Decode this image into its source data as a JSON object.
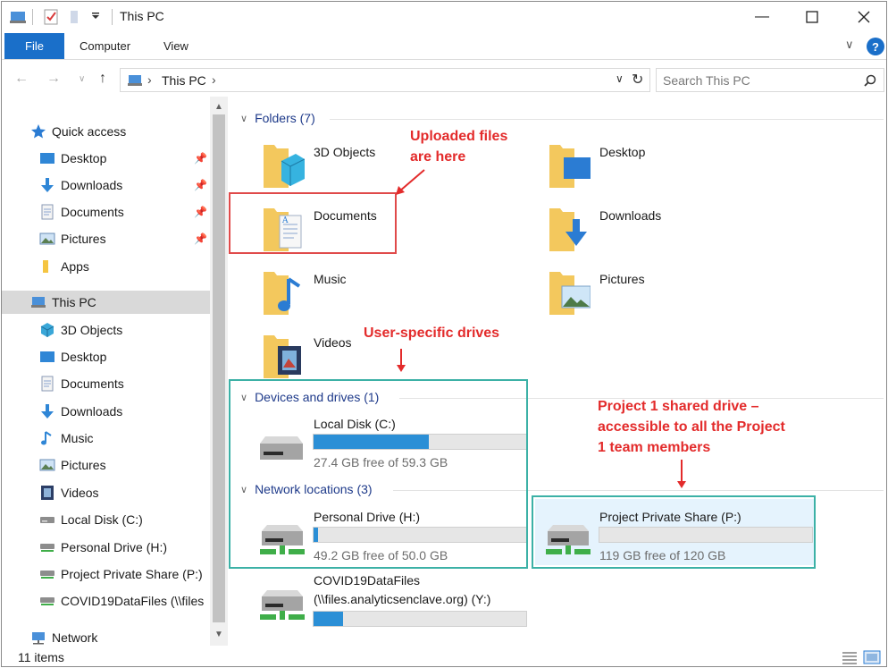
{
  "window": {
    "title": "This PC"
  },
  "ribbon": {
    "tabs": [
      "File",
      "Computer",
      "View"
    ],
    "help": "?"
  },
  "address": {
    "path": [
      "This PC"
    ],
    "search_placeholder": "Search This PC"
  },
  "sidebar": {
    "quick_access": "Quick access",
    "quick_items": [
      {
        "label": "Desktop",
        "icon": "desktop-icon",
        "pinned": true
      },
      {
        "label": "Downloads",
        "icon": "download-icon",
        "pinned": true
      },
      {
        "label": "Documents",
        "icon": "document-icon",
        "pinned": true
      },
      {
        "label": "Pictures",
        "icon": "pictures-icon",
        "pinned": true
      },
      {
        "label": "Apps",
        "icon": "folder-icon",
        "pinned": false
      }
    ],
    "this_pc": "This PC",
    "pc_items": [
      {
        "label": "3D Objects",
        "icon": "cube-icon"
      },
      {
        "label": "Desktop",
        "icon": "desktop-icon"
      },
      {
        "label": "Documents",
        "icon": "document-icon"
      },
      {
        "label": "Downloads",
        "icon": "download-icon"
      },
      {
        "label": "Music",
        "icon": "music-icon"
      },
      {
        "label": "Pictures",
        "icon": "pictures-icon"
      },
      {
        "label": "Videos",
        "icon": "videos-icon"
      },
      {
        "label": "Local Disk (C:)",
        "icon": "disk-icon"
      },
      {
        "label": "Personal Drive (H:)",
        "icon": "network-drive-icon"
      },
      {
        "label": "Project Private Share (P:)",
        "icon": "network-drive-icon"
      },
      {
        "label": "COVID19DataFiles (\\\\files",
        "icon": "network-drive-icon"
      }
    ],
    "network": "Network"
  },
  "content": {
    "folders_header": "Folders (7)",
    "folders": [
      {
        "label": "3D Objects",
        "icon": "cube-icon"
      },
      {
        "label": "Desktop",
        "icon": "desktop-icon"
      },
      {
        "label": "Documents",
        "icon": "document-icon"
      },
      {
        "label": "Downloads",
        "icon": "download-icon"
      },
      {
        "label": "Music",
        "icon": "music-icon"
      },
      {
        "label": "Pictures",
        "icon": "pictures-icon"
      },
      {
        "label": "Videos",
        "icon": "videos-icon"
      }
    ],
    "devices_header": "Devices and drives (1)",
    "network_header": "Network locations (3)",
    "drives": [
      {
        "label": "Local Disk (C:)",
        "free": "27.4 GB free of 59.3 GB",
        "used_fraction": 0.54
      },
      {
        "label": "Personal Drive (H:)",
        "free": "49.2 GB free of 50.0 GB",
        "used_fraction": 0.02
      },
      {
        "label": "Project Private Share (P:)",
        "free": "119 GB free of 120 GB",
        "used_fraction": 0.0
      },
      {
        "label_line1": "COVID19DataFiles",
        "label_line2": "(\\\\files.analyticsenclave.org) (Y:)",
        "used_fraction": 0.14
      }
    ]
  },
  "annotations": {
    "uploaded": [
      "Uploaded files",
      "are here"
    ],
    "user_drives": "User-specific drives",
    "project": [
      "Project 1 shared drive –",
      "accessible to all the Project",
      "1 team members"
    ]
  },
  "status": {
    "items": "11 items"
  },
  "colors": {
    "accent": "#1a6fc9",
    "annotation_red": "#e32b2b",
    "annotation_teal": "#3cb1a6",
    "bar_fill": "#2b8fd6"
  }
}
